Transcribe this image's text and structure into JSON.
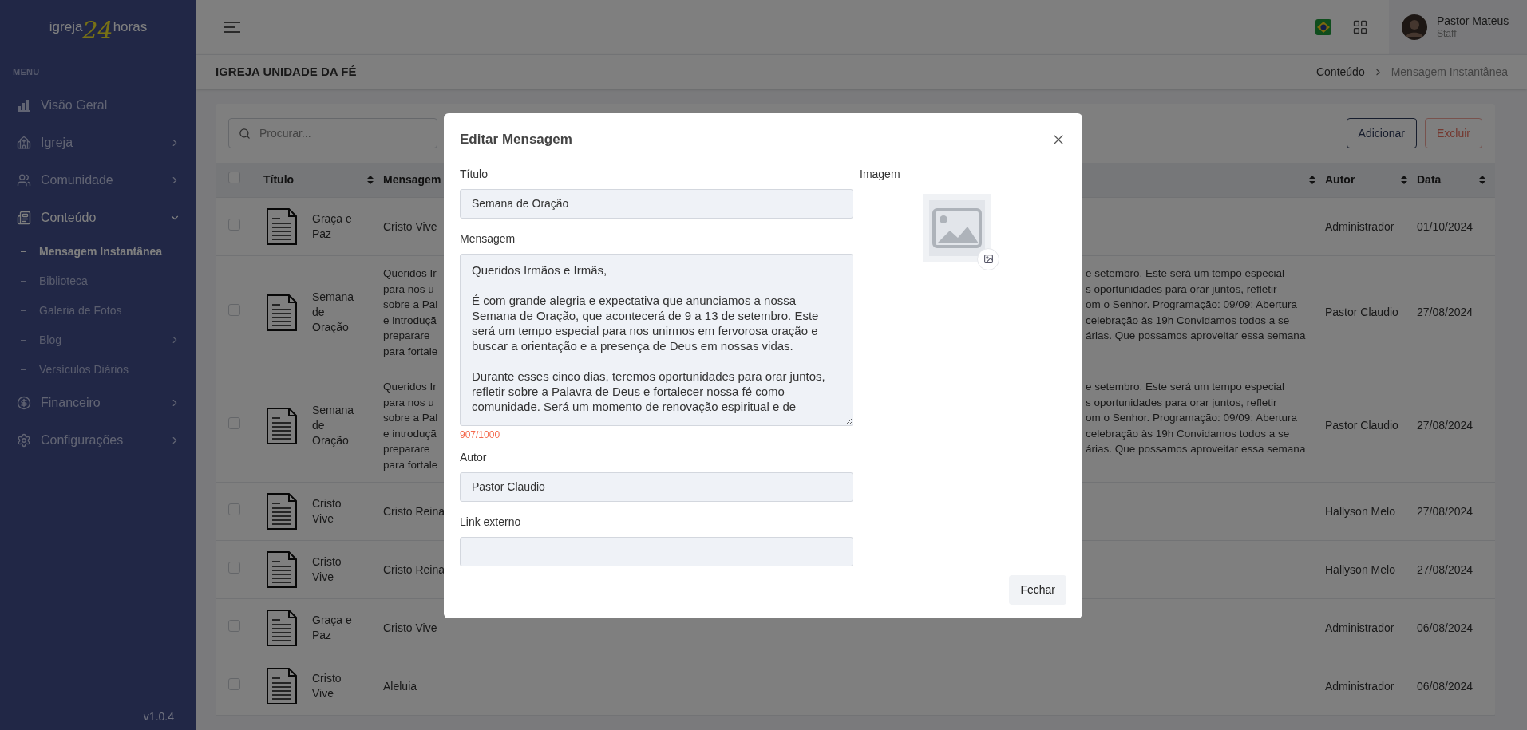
{
  "sidebar": {
    "logo": {
      "left": "igreja",
      "number": "24",
      "right": "horas"
    },
    "menu_label": "MENU",
    "items": [
      {
        "label": "Visão Geral",
        "has_submenu": false,
        "expanded": false,
        "selected": false
      },
      {
        "label": "Igreja",
        "has_submenu": true,
        "expanded": false,
        "selected": false
      },
      {
        "label": "Comunidade",
        "has_submenu": true,
        "expanded": false,
        "selected": false
      },
      {
        "label": "Conteúdo",
        "has_submenu": true,
        "expanded": true,
        "selected": true,
        "children": [
          {
            "label": "Mensagem Instantânea",
            "has_submenu": false,
            "selected": true
          },
          {
            "label": "Biblioteca",
            "has_submenu": false,
            "selected": false
          },
          {
            "label": "Galeria de Fotos",
            "has_submenu": false,
            "selected": false
          },
          {
            "label": "Blog",
            "has_submenu": true,
            "selected": false
          },
          {
            "label": "Versículos Diários",
            "has_submenu": false,
            "selected": false
          }
        ]
      },
      {
        "label": "Financeiro",
        "has_submenu": true,
        "expanded": false,
        "selected": false
      },
      {
        "label": "Configurações",
        "has_submenu": true,
        "expanded": false,
        "selected": false
      }
    ],
    "version": "v1.0.4"
  },
  "topbar": {
    "user": {
      "name": "Pastor Mateus",
      "role": "Staff"
    }
  },
  "page_header": {
    "title": "IGREJA UNIDADE DA FÉ",
    "breadcrumb": [
      "Conteúdo",
      "Mensagem Instantânea"
    ]
  },
  "toolbar": {
    "search": {
      "placeholder": "Procurar..."
    },
    "buttons": [
      {
        "label": "Adicionar",
        "kind": "primary"
      },
      {
        "label": "Excluir",
        "kind": "danger"
      }
    ]
  },
  "table": {
    "header_checked": false,
    "columns": [
      {
        "label": "Título"
      },
      {
        "label": "Mensagem"
      },
      {
        "label": "Autor"
      },
      {
        "label": "Data"
      }
    ],
    "rows": [
      {
        "checked": false,
        "kind": "short",
        "title": "Graça e Paz",
        "message": "Cristo Vive",
        "author": "Administrador",
        "date": "01/10/2024"
      },
      {
        "checked": false,
        "kind": "long",
        "title": "Semana de Oração",
        "message_left": [
          "Queridos Ir",
          "para nos u",
          "sobre a Pal",
          "e introduçã",
          "preparare",
          "para fortale"
        ],
        "message_right": [
          "e setembro. Este será um tempo especial",
          "s oportunidades para orar juntos, refletir",
          "om o Senhor. Programação: 09/09: Abertura",
          "celebração às 19h Convidamos todos a se",
          "árias. Que possamos aproveitar essa semana"
        ],
        "author": "Pastor Claudio",
        "date": "27/08/2024"
      },
      {
        "checked": false,
        "kind": "long",
        "title": "Semana de Oração",
        "message_left": [
          "Queridos Ir",
          "para nos u",
          "sobre a Pal",
          "e introduçã",
          "preparare",
          "para fortale"
        ],
        "message_right": [
          "e setembro. Este será um tempo especial",
          "s oportunidades para orar juntos, refletir",
          "om o Senhor. Programação: 09/09: Abertura",
          "celebração às 19h Convidamos todos a se",
          "árias. Que possamos aproveitar essa semana"
        ],
        "author": "Pastor Claudio",
        "date": "27/08/2024"
      },
      {
        "checked": false,
        "kind": "short",
        "title": "Cristo Vive",
        "message": "Cristo Reina",
        "author": "Hallyson Melo",
        "date": "27/08/2024"
      },
      {
        "checked": false,
        "kind": "short",
        "title": "Cristo Vive",
        "message": "Cristo Reina",
        "author": "Hallyson Melo",
        "date": "27/08/2024"
      },
      {
        "checked": false,
        "kind": "short",
        "title": "Graça e Paz",
        "message": "Cristo Vive",
        "author": "Administrador",
        "date": "06/08/2024"
      },
      {
        "checked": false,
        "kind": "short",
        "title": "Cristo Vive",
        "message": "Aleluia",
        "author": "Administrador",
        "date": "06/08/2024"
      }
    ]
  },
  "modal": {
    "title": "Editar Mensagem",
    "fields": [
      {
        "label": "Título",
        "kind": "input",
        "value": "Semana de Oração"
      },
      {
        "label": "Mensagem",
        "kind": "textarea",
        "value": "Queridos Irmãos e Irmãs,\n\nÉ com grande alegria e expectativa que anunciamos a nossa Semana de Oração, que acontecerá de 9 a 13 de setembro. Este será um tempo especial para nos unirmos em fervorosa oração e buscar a orientação e a presença de Deus em nossas vidas.\n\nDurante esses cinco dias, teremos oportunidades para orar juntos, refletir sobre a Palavra de Deus e fortalecer nossa fé como comunidade. Será um momento de renovação espiritual e de",
        "counter": "907/1000"
      },
      {
        "label": "Autor",
        "kind": "input",
        "value": "Pastor Claudio"
      },
      {
        "label": "Link externo",
        "kind": "input"
      }
    ],
    "image_label": "Imagem",
    "close_button": "Fechar"
  }
}
